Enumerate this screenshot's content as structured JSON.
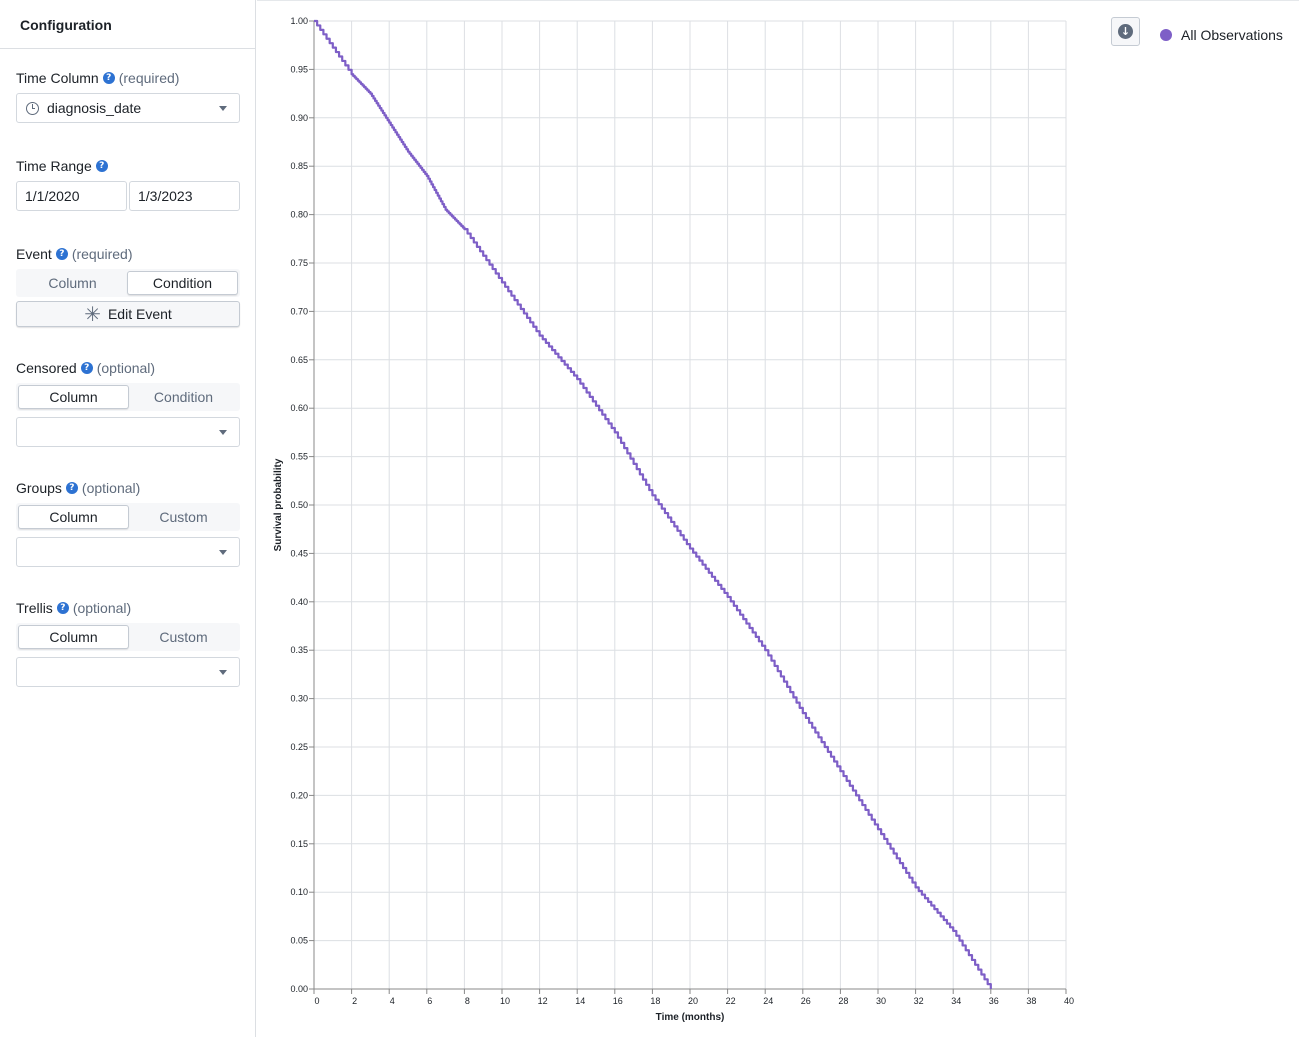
{
  "sidebar": {
    "title": "Configuration",
    "time_column": {
      "label": "Time Column",
      "qualifier": "(required)",
      "value": "diagnosis_date"
    },
    "time_range": {
      "label": "Time Range",
      "start": "1/1/2020",
      "end": "1/3/2023"
    },
    "event": {
      "label": "Event",
      "qualifier": "(required)",
      "options": [
        "Column",
        "Condition"
      ],
      "selected": "Condition",
      "edit_label": "Edit Event"
    },
    "censored": {
      "label": "Censored",
      "qualifier": "(optional)",
      "options": [
        "Column",
        "Condition"
      ],
      "selected": "Column",
      "value": ""
    },
    "groups": {
      "label": "Groups",
      "qualifier": "(optional)",
      "options": [
        "Column",
        "Custom"
      ],
      "selected": "Column",
      "value": ""
    },
    "trellis": {
      "label": "Trellis",
      "qualifier": "(optional)",
      "options": [
        "Column",
        "Custom"
      ],
      "selected": "Column",
      "value": ""
    }
  },
  "colors": {
    "series": "#7e5fc7",
    "accent": "#2d72d2",
    "grid": "#dcdfe3"
  },
  "icons": {
    "time_column": "clock-icon",
    "edit_event": "asterisk-icon",
    "download": "download-icon",
    "dropdown": "caret-down-icon",
    "help": "help-icon"
  },
  "chart_data": {
    "type": "line",
    "title": "",
    "xlabel": "Time (months)",
    "ylabel": "Survival probability",
    "xlim": [
      0,
      40
    ],
    "ylim": [
      0,
      1
    ],
    "x_ticks": [
      0,
      2,
      4,
      6,
      8,
      10,
      12,
      14,
      16,
      18,
      20,
      22,
      24,
      26,
      28,
      30,
      32,
      34,
      36,
      38,
      40
    ],
    "y_ticks": [
      "0.00",
      "0.05",
      "0.10",
      "0.15",
      "0.20",
      "0.25",
      "0.30",
      "0.35",
      "0.40",
      "0.45",
      "0.50",
      "0.55",
      "0.60",
      "0.65",
      "0.70",
      "0.75",
      "0.80",
      "0.85",
      "0.90",
      "0.95",
      "1.00"
    ],
    "grid": true,
    "legend_position": "top-right",
    "series": [
      {
        "name": "All Observations",
        "x": [
          0,
          2,
          3,
          4,
          5,
          6,
          7,
          8,
          10,
          12,
          14,
          16,
          18,
          20,
          22,
          24,
          26,
          28,
          30,
          32,
          34,
          36
        ],
        "y": [
          1.0,
          0.945,
          0.925,
          0.895,
          0.865,
          0.84,
          0.805,
          0.785,
          0.73,
          0.675,
          0.63,
          0.575,
          0.51,
          0.455,
          0.405,
          0.35,
          0.285,
          0.225,
          0.165,
          0.105,
          0.06,
          0.0
        ]
      }
    ]
  }
}
